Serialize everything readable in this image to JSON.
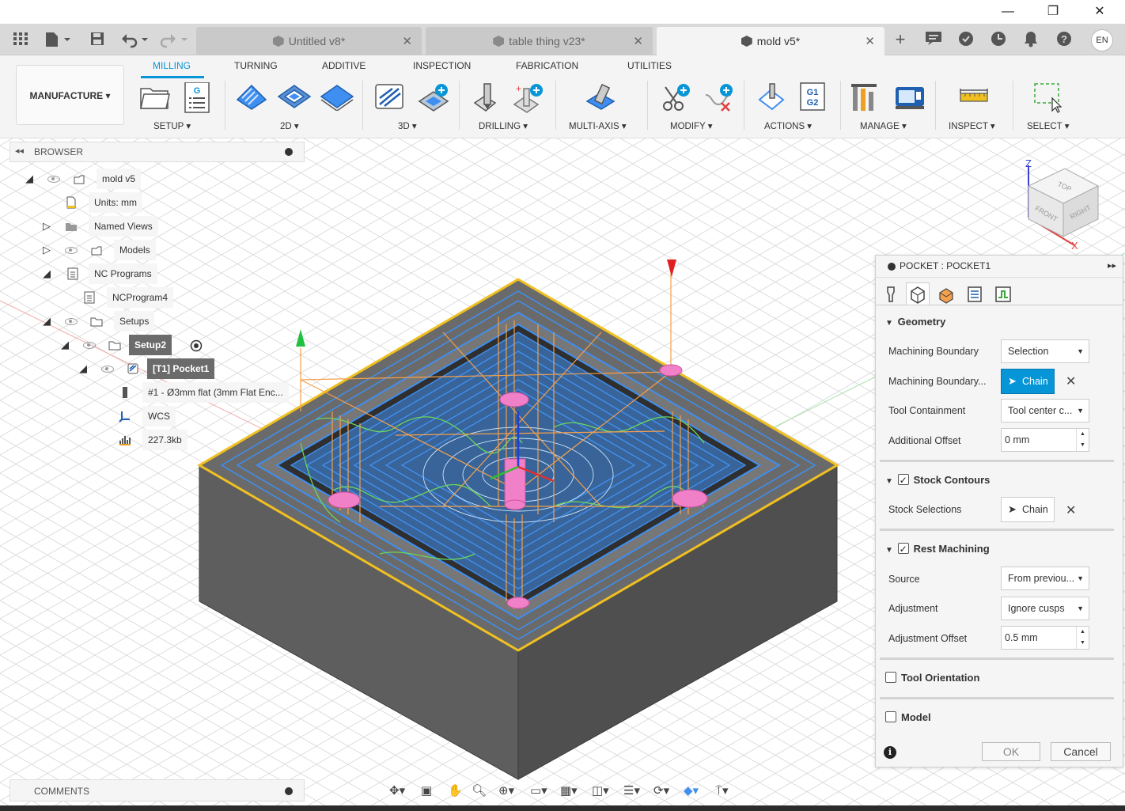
{
  "window": {
    "minimize": "—",
    "restore": "❐",
    "close": "✕"
  },
  "tabs": [
    {
      "label": "Untitled v8*"
    },
    {
      "label": "table thing v23*"
    },
    {
      "label": "mold v5*"
    }
  ],
  "header": {
    "user_initials": "EN"
  },
  "ribbon": {
    "workspace": "MANUFACTURE ▾",
    "tabs": [
      "MILLING",
      "TURNING",
      "ADDITIVE",
      "INSPECTION",
      "FABRICATION",
      "UTILITIES"
    ],
    "groups": [
      "SETUP ▾",
      "2D ▾",
      "3D ▾",
      "DRILLING ▾",
      "MULTI-AXIS ▾",
      "MODIFY ▾",
      "ACTIONS ▾",
      "MANAGE ▾",
      "INSPECT ▾",
      "SELECT ▾"
    ]
  },
  "browser": {
    "title": "BROWSER",
    "items": [
      {
        "label": "mold v5"
      },
      {
        "label": "Units: mm"
      },
      {
        "label": "Named Views"
      },
      {
        "label": "Models"
      },
      {
        "label": "NC Programs"
      },
      {
        "label": "NCProgram4"
      },
      {
        "label": "Setups"
      },
      {
        "label": "Setup2"
      },
      {
        "label": "[T1] Pocket1"
      },
      {
        "label": "#1 - Ø3mm flat (3mm Flat Enc..."
      },
      {
        "label": "WCS"
      },
      {
        "label": "227.3kb"
      }
    ]
  },
  "comments": {
    "title": "COMMENTS"
  },
  "viewcube": {
    "top": "TOP",
    "front": "FRONT",
    "right": "RIGHT",
    "axis_z": "Z",
    "axis_x": "X"
  },
  "panel": {
    "title": "POCKET : POCKET1",
    "sections": {
      "geometry": "Geometry",
      "stock_contours": "Stock Contours",
      "rest_machining": "Rest Machining",
      "tool_orientation": "Tool Orientation",
      "model": "Model"
    },
    "fields": {
      "machining_boundary": {
        "label": "Machining Boundary",
        "value": "Selection"
      },
      "machining_boundary_sel": {
        "label": "Machining Boundary...",
        "value": "Chain"
      },
      "tool_containment": {
        "label": "Tool Containment",
        "value": "Tool center c..."
      },
      "additional_offset": {
        "label": "Additional Offset",
        "value": "0 mm"
      },
      "stock_selections": {
        "label": "Stock Selections",
        "value": "Chain"
      },
      "source": {
        "label": "Source",
        "value": "From previou..."
      },
      "adjustment": {
        "label": "Adjustment",
        "value": "Ignore cusps"
      },
      "adjustment_offset": {
        "label": "Adjustment Offset",
        "value": "0.5 mm"
      }
    },
    "ok": "OK",
    "cancel": "Cancel"
  },
  "colors": {
    "accent": "#0696d7",
    "stock": "#5c5c5c",
    "toolpath_blue": "#3f8ff0",
    "toolpath_orange": "#f5a04a",
    "toolpath_green": "#6bd65a",
    "boundary": "#f0c020"
  }
}
